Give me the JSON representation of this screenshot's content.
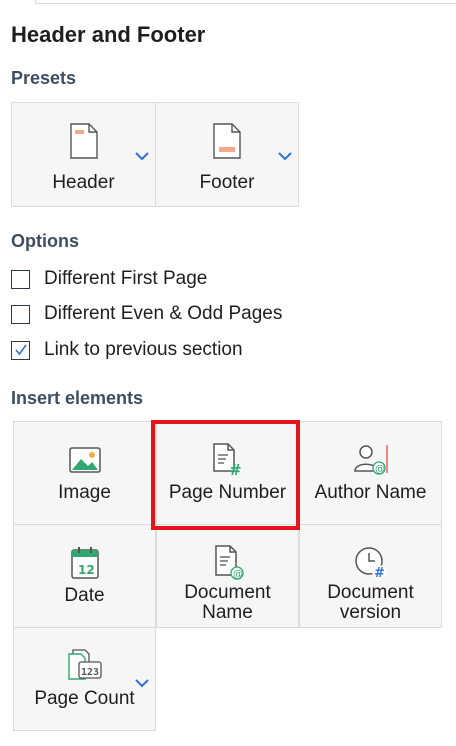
{
  "panel": {
    "title": "Header and Footer"
  },
  "presets": {
    "title": "Presets",
    "items": [
      {
        "label": "Header",
        "icon": "header-page-icon"
      },
      {
        "label": "Footer",
        "icon": "footer-page-icon"
      }
    ]
  },
  "options": {
    "title": "Options",
    "items": [
      {
        "label": "Different First Page",
        "checked": false
      },
      {
        "label": "Different Even & Odd Pages",
        "checked": false
      },
      {
        "label": "Link to previous section",
        "checked": true
      }
    ]
  },
  "insert": {
    "title": "Insert elements",
    "items": [
      {
        "label": "Image",
        "icon": "image-icon"
      },
      {
        "label": "Page Number",
        "icon": "page-number-icon",
        "highlighted": true
      },
      {
        "label": "Author Name",
        "icon": "author-name-icon"
      },
      {
        "label": "Date",
        "icon": "calendar-icon"
      },
      {
        "label_line1": "Document",
        "label_line2": "Name",
        "icon": "document-name-icon"
      },
      {
        "label_line1": "Document",
        "label_line2": "version",
        "icon": "document-version-icon"
      },
      {
        "label": "Page Count",
        "icon": "page-count-icon",
        "has_dropdown": true
      }
    ]
  },
  "colors": {
    "accent_blue": "#2f6fd6",
    "icon_green": "#2fa872",
    "highlight_red": "#e3161b",
    "section_title": "#3e4e62"
  }
}
